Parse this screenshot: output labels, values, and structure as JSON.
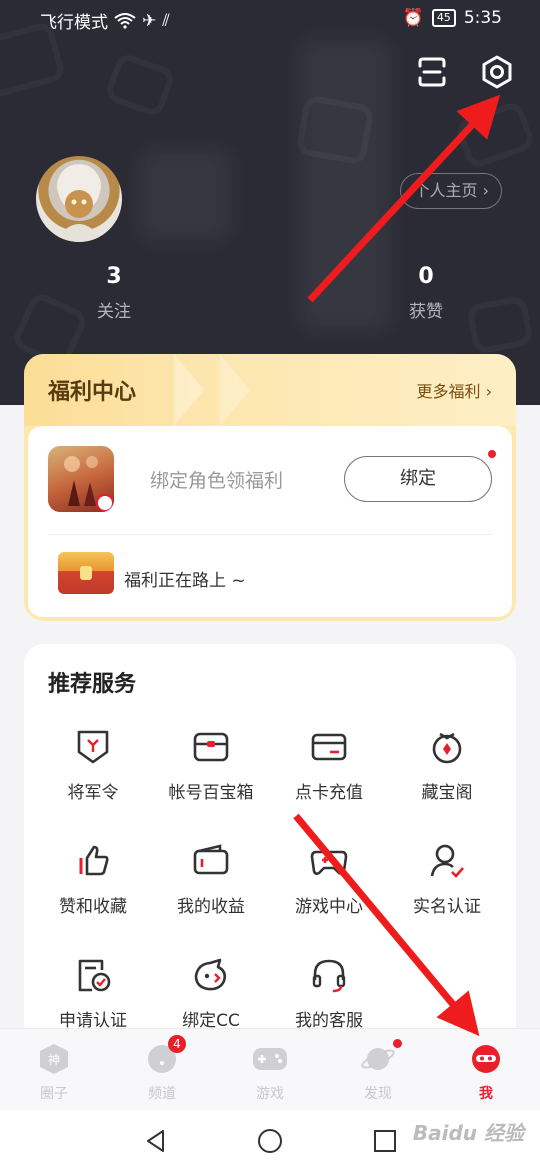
{
  "status_bar": {
    "left_text": "飞行模式",
    "battery": "45",
    "time": "5:35"
  },
  "header": {
    "profile_button": "个人主页",
    "stats": [
      {
        "value": "3",
        "label": "关注"
      },
      {
        "value": "0",
        "label": "获赞"
      }
    ]
  },
  "welfare": {
    "title": "福利中心",
    "more": "更多福利",
    "bind_text": "绑定角色领福利",
    "bind_button": "绑定",
    "onway_text": "福利正在路上 ~"
  },
  "services": {
    "title": "推荐服务",
    "items": [
      {
        "label": "将军令",
        "icon": "shield-icon"
      },
      {
        "label": "帐号百宝箱",
        "icon": "toolbox-icon"
      },
      {
        "label": "点卡充值",
        "icon": "card-icon"
      },
      {
        "label": "藏宝阁",
        "icon": "treasure-icon"
      },
      {
        "label": "赞和收藏",
        "icon": "thumbs-up-icon"
      },
      {
        "label": "我的收益",
        "icon": "wallet-icon"
      },
      {
        "label": "游戏中心",
        "icon": "gamepad-icon"
      },
      {
        "label": "实名认证",
        "icon": "user-check-icon"
      },
      {
        "label": "申请认证",
        "icon": "document-check-icon"
      },
      {
        "label": "绑定CC",
        "icon": "cc-icon"
      },
      {
        "label": "我的客服",
        "icon": "headset-icon"
      }
    ]
  },
  "tabbar": {
    "tabs": [
      {
        "label": "圈子",
        "icon": "circle-icon"
      },
      {
        "label": "频道",
        "icon": "channel-icon",
        "badge": "4"
      },
      {
        "label": "游戏",
        "icon": "gamepad-icon"
      },
      {
        "label": "发现",
        "icon": "planet-icon"
      },
      {
        "label": "我",
        "icon": "me-icon"
      }
    ]
  },
  "watermark": "Baidu 经验",
  "colors": {
    "accent": "#e8202a",
    "header_bg": "#2b2b36",
    "welfare_bg": "#fde9b0"
  }
}
